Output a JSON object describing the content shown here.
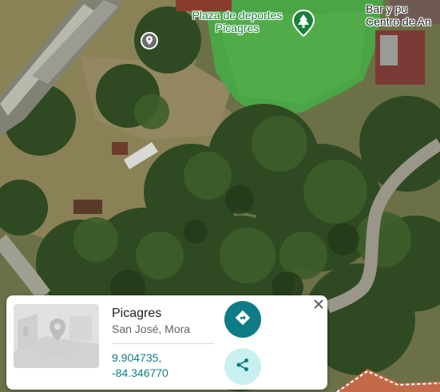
{
  "map": {
    "labels": {
      "plaza": "Plaza de deportes\nPicagres",
      "bar": "Bar y pu\nCentro de An"
    },
    "icons": [
      "tree-icon",
      "location-pin-icon"
    ],
    "colors": {
      "park": "#188038",
      "accent": "#0e7c86"
    }
  },
  "card": {
    "title": "Picagres",
    "subtitle": "San José, Mora",
    "latitude": "9.904735,",
    "longitude": "-84.346770",
    "icons": [
      "directions-icon",
      "share-icon",
      "close-icon"
    ]
  }
}
